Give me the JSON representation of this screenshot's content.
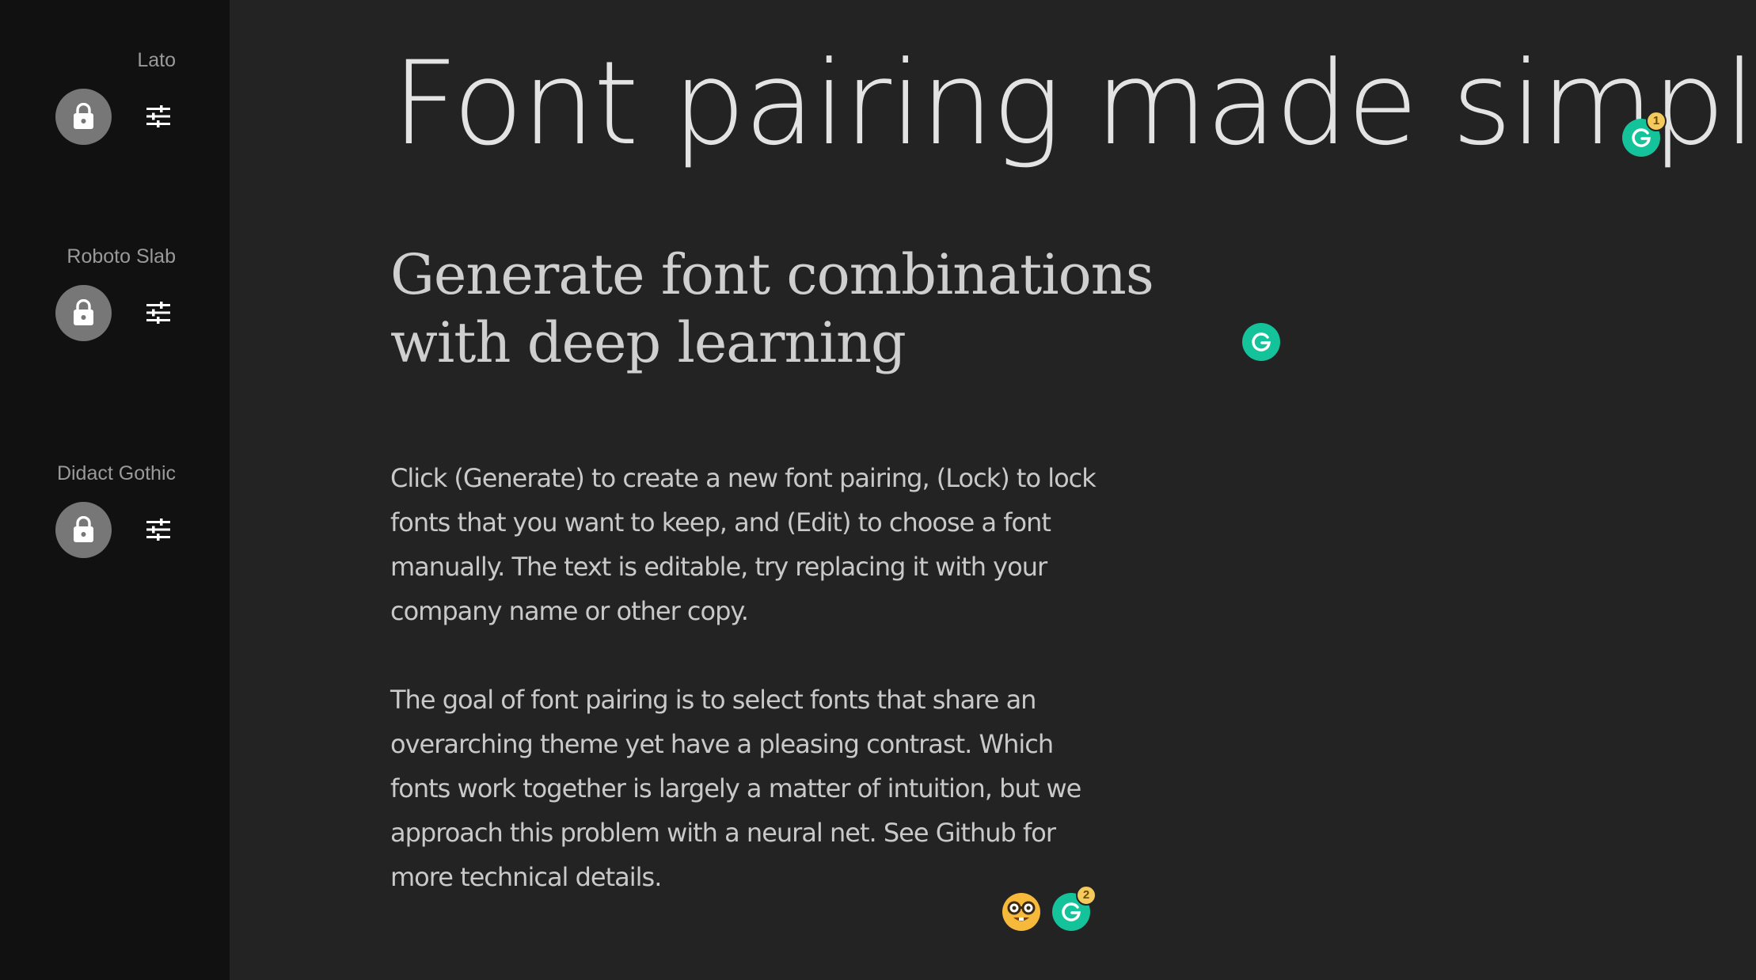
{
  "sidebar": {
    "fonts": [
      {
        "name": "Lato",
        "lock_icon": "lock-icon",
        "edit_icon": "sliders-icon"
      },
      {
        "name": "Roboto Slab",
        "lock_icon": "lock-icon",
        "edit_icon": "sliders-icon"
      },
      {
        "name": "Didact Gothic",
        "lock_icon": "lock-icon",
        "edit_icon": "sliders-icon"
      }
    ]
  },
  "main": {
    "headline": "Font pairing made simple",
    "subheadline": "Generate font combinations with deep learning",
    "paragraphs": [
      "Click (Generate) to create a new font pairing, (Lock) to lock fonts that you want to keep, and (Edit) to choose a font manually. The text is editable, try replacing it with your company name or other copy.",
      "The goal of font pairing is to select fonts that share an overarching theme yet have a pleasing contrast. Which fonts work together is largely a matter of intuition, but we approach this problem with a neural net. See Github for more technical details."
    ]
  },
  "overlays": {
    "grammarly_headline_count": "1",
    "grammarly_body_count": "2",
    "emoji": "🤓",
    "colors": {
      "grammarly_green": "#15c39a",
      "badge_yellow": "#f4c95d"
    }
  }
}
